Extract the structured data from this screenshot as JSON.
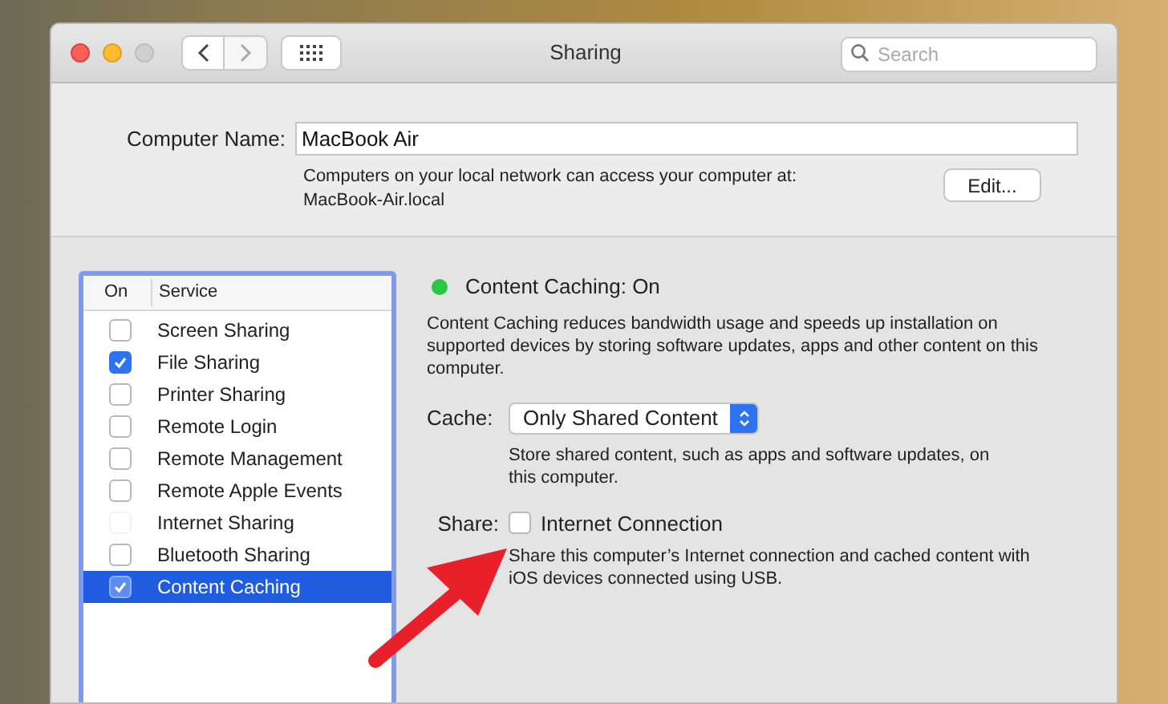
{
  "window": {
    "title": "Sharing"
  },
  "search": {
    "placeholder": "Search"
  },
  "computer_name": {
    "label": "Computer Name:",
    "value": "MacBook Air",
    "note": "Computers on your local network can access your computer at:",
    "address": "MacBook-Air.local",
    "edit_button": "Edit..."
  },
  "services": {
    "columns": [
      "On",
      "Service"
    ],
    "rows": [
      {
        "name": "Screen Sharing",
        "checked": false,
        "disabled": false,
        "selected": false
      },
      {
        "name": "File Sharing",
        "checked": true,
        "disabled": false,
        "selected": false
      },
      {
        "name": "Printer Sharing",
        "checked": false,
        "disabled": false,
        "selected": false
      },
      {
        "name": "Remote Login",
        "checked": false,
        "disabled": false,
        "selected": false
      },
      {
        "name": "Remote Management",
        "checked": false,
        "disabled": false,
        "selected": false
      },
      {
        "name": "Remote Apple Events",
        "checked": false,
        "disabled": false,
        "selected": false
      },
      {
        "name": "Internet Sharing",
        "checked": false,
        "disabled": true,
        "selected": false
      },
      {
        "name": "Bluetooth Sharing",
        "checked": false,
        "disabled": false,
        "selected": false
      },
      {
        "name": "Content Caching",
        "checked": true,
        "disabled": false,
        "selected": true
      }
    ]
  },
  "detail": {
    "status": "Content Caching: On",
    "description": "Content Caching reduces bandwidth usage and speeds up installation on supported devices by storing software updates, apps and other content on this computer.",
    "cache_label": "Cache:",
    "cache_value": "Only Shared Content",
    "cache_note": "Store shared content, such as apps and software updates, on this computer.",
    "share_label": "Share:",
    "share_option": "Internet Connection",
    "share_checked": false,
    "share_note": "Share this computer’s Internet connection and cached content with iOS devices connected using USB."
  }
}
